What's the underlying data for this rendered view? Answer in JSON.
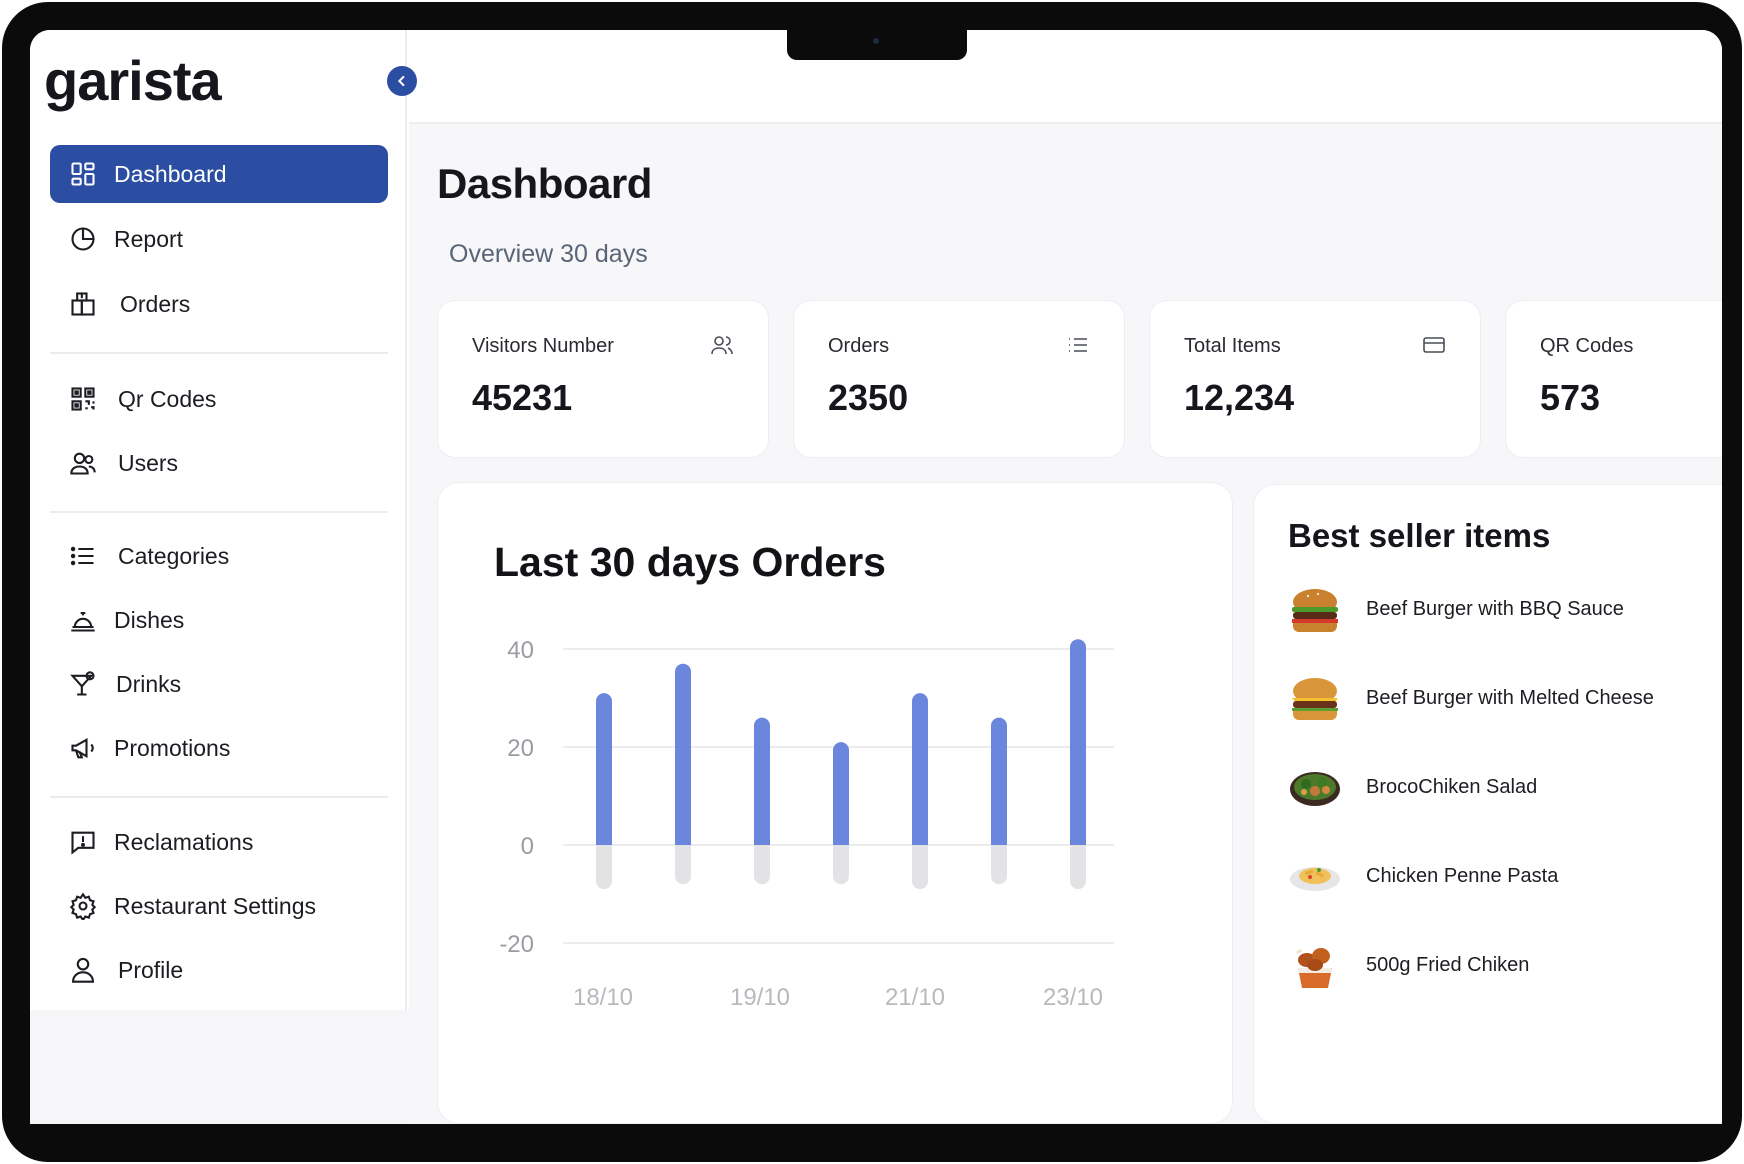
{
  "app": {
    "logo": "garista"
  },
  "sidebar": {
    "items": [
      {
        "label": "Dashboard",
        "icon": "grid-icon",
        "active": true
      },
      {
        "label": "Report",
        "icon": "pie-chart-icon"
      },
      {
        "label": "Orders",
        "icon": "package-icon"
      },
      {
        "label": "Qr Codes",
        "icon": "qr-code-icon"
      },
      {
        "label": "Users",
        "icon": "users-icon"
      },
      {
        "label": "Categories",
        "icon": "list-icon"
      },
      {
        "label": "Dishes",
        "icon": "cloche-icon"
      },
      {
        "label": "Drinks",
        "icon": "cocktail-icon"
      },
      {
        "label": "Promotions",
        "icon": "megaphone-icon"
      },
      {
        "label": "Reclamations",
        "icon": "message-alert-icon"
      },
      {
        "label": "Restaurant Settings",
        "icon": "gear-icon"
      },
      {
        "label": "Profile",
        "icon": "user-icon"
      }
    ]
  },
  "main": {
    "title": "Dashboard",
    "subtitle": "Overview 30 days",
    "stats": [
      {
        "label": "Visitors Number",
        "value": "45231",
        "icon": "users-icon"
      },
      {
        "label": "Orders",
        "value": "2350",
        "icon": "list-icon"
      },
      {
        "label": "Total Items",
        "value": "12,234",
        "icon": "card-icon"
      },
      {
        "label": "QR Codes",
        "value": "573",
        "icon": "qr-code-icon"
      }
    ],
    "best_sellers": {
      "title": "Best seller items",
      "items": [
        {
          "name": "Beef Burger with BBQ Sauce",
          "image": "burger-bbq"
        },
        {
          "name": "Beef Burger with Melted Cheese",
          "image": "burger-cheese"
        },
        {
          "name": "BrocoChiken Salad",
          "image": "salad"
        },
        {
          "name": "Chicken Penne Pasta",
          "image": "pasta"
        },
        {
          "name": "500g Fried Chiken",
          "image": "fried-chicken"
        }
      ]
    }
  },
  "chart_data": {
    "type": "bar",
    "title": "Last 30 days Orders",
    "x_tick_labels": [
      "18/10",
      "19/10",
      "21/10",
      "23/10"
    ],
    "ylim": [
      -20,
      40
    ],
    "y_ticks": [
      40,
      20,
      0,
      -20
    ],
    "grid": true,
    "series": [
      {
        "values": [
          31,
          37,
          26,
          21,
          31,
          26,
          42
        ],
        "color": "#6a86dd"
      },
      {
        "values": [
          -9,
          -8,
          -8,
          -8,
          -9,
          -8,
          -9
        ],
        "color": "#e3e3e5"
      }
    ]
  }
}
